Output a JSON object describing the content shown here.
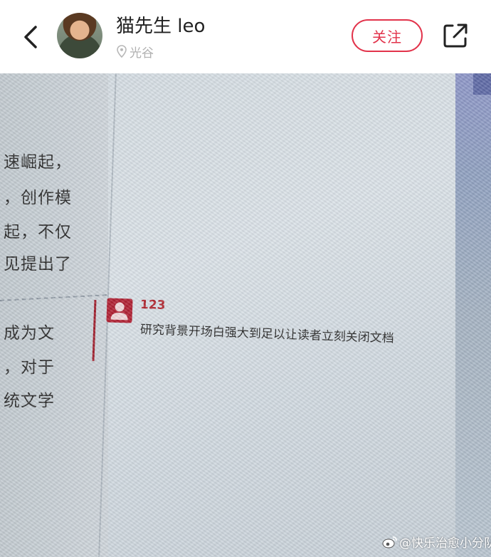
{
  "header": {
    "back_icon": "chevron-left-icon",
    "user_name": "猫先生 leo",
    "location_icon": "location-pin-icon",
    "location": "光谷",
    "follow_label": "关注",
    "share_icon": "share-external-icon",
    "accent_color": "#e2334b"
  },
  "photo": {
    "document_left_lines": [
      "速崛起，",
      "，创作模",
      "起，不仅",
      "见提出了",
      "成为文",
      "，对于",
      "统文学"
    ],
    "comment": {
      "avatar_icon": "user-silhouette-icon",
      "user": "123",
      "text": "研究背景开场白强大到足以让读者立刻关闭文档"
    },
    "watermark": {
      "icon": "weibo-logo-icon",
      "text": "@快乐治愈小分队"
    }
  }
}
